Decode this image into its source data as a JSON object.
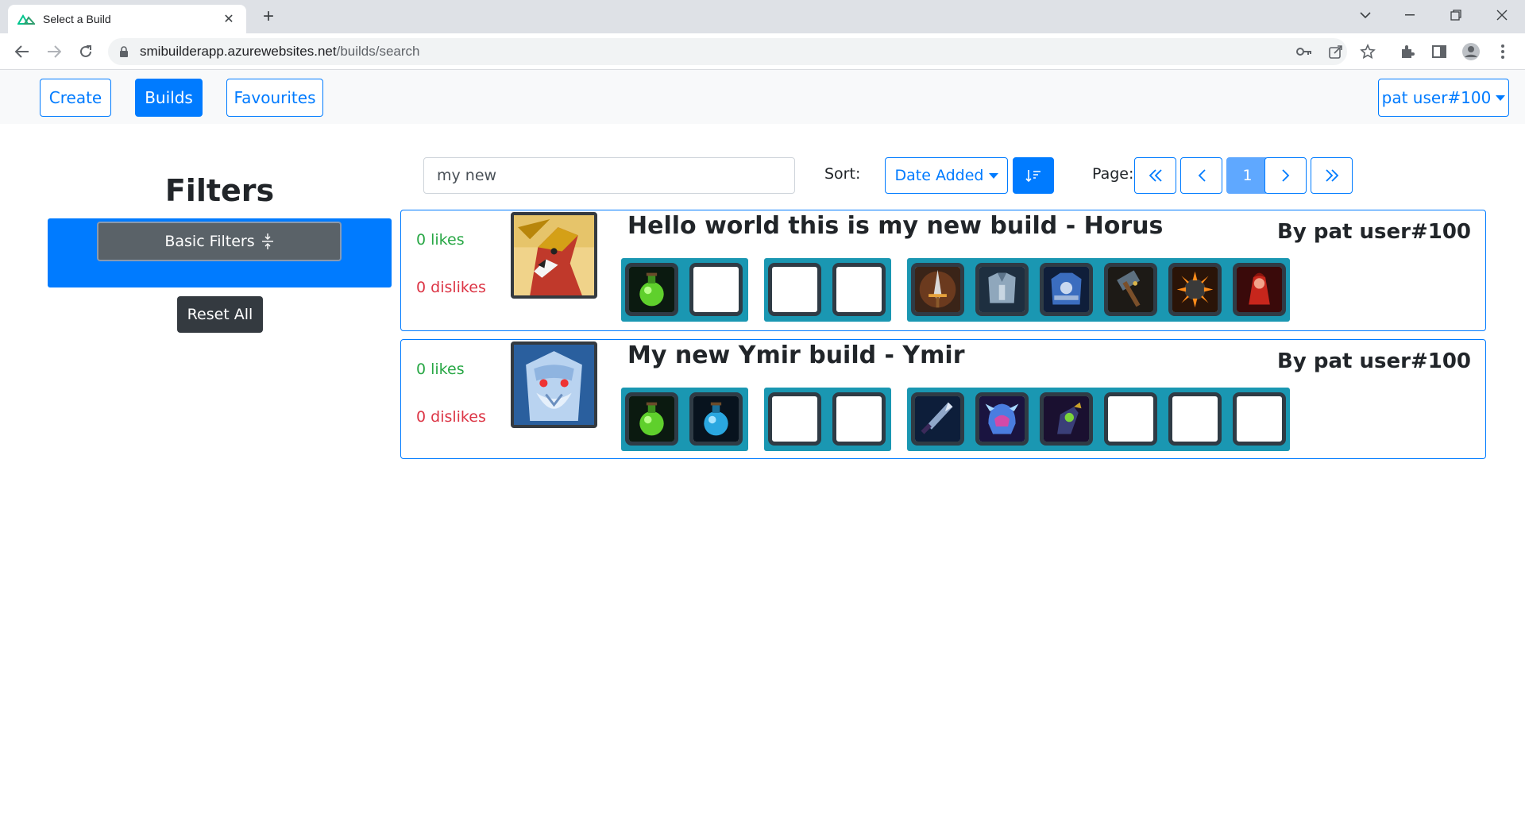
{
  "browser": {
    "tab_title": "Select a Build",
    "url_host": "smibuilderapp.azurewebsites.net",
    "url_path": "/builds/search"
  },
  "nav": {
    "create": "Create",
    "builds": "Builds",
    "favourites": "Favourites",
    "user": "pat user#100"
  },
  "filters": {
    "title": "Filters",
    "basic_filters": "Basic Filters",
    "reset_all": "Reset All"
  },
  "search": {
    "value": "my new",
    "sort_label": "Sort:",
    "sort_value": "Date Added",
    "page_label": "Page:",
    "current_page": "1"
  },
  "builds": [
    {
      "likes": "0 likes",
      "dislikes": "0 dislikes",
      "title": "Hello world this is my new build - Horus",
      "author": "By pat user#100",
      "god_icon": "horus-portrait-icon",
      "relics": [
        "green-potion-icon",
        "empty"
      ],
      "consumables": [
        "empty",
        "empty"
      ],
      "items": [
        "sword-icon",
        "armor-icon",
        "blue-armor-icon",
        "hammer-icon",
        "spiked-mace-icon",
        "red-cloak-icon"
      ]
    },
    {
      "likes": "0 likes",
      "dislikes": "0 dislikes",
      "title": "My new Ymir build - Ymir",
      "author": "By pat user#100",
      "god_icon": "ymir-portrait-icon",
      "relics": [
        "green-potion-icon",
        "blue-potion-icon"
      ],
      "consumables": [
        "empty",
        "empty"
      ],
      "items": [
        "dagger-icon",
        "frost-helm-icon",
        "gauntlet-icon",
        "empty",
        "empty",
        "empty"
      ]
    }
  ]
}
